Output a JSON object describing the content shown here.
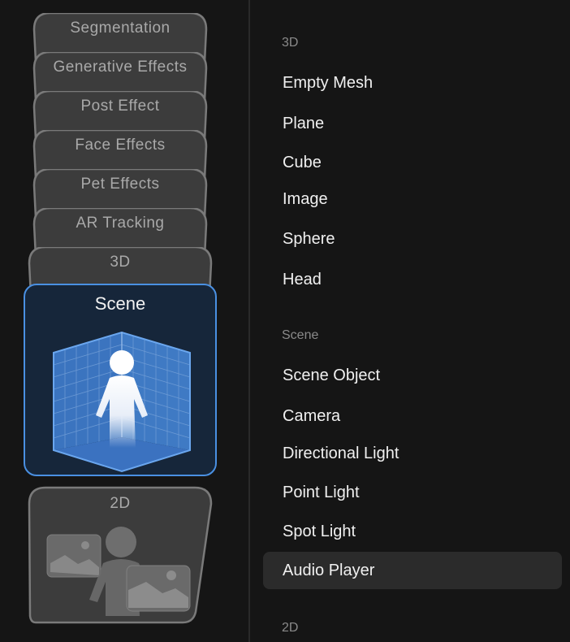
{
  "stack": {
    "cards": [
      {
        "label": "Segmentation"
      },
      {
        "label": "Generative Effects"
      },
      {
        "label": "Post Effect"
      },
      {
        "label": "Face Effects"
      },
      {
        "label": "Pet Effects"
      },
      {
        "label": "AR Tracking"
      },
      {
        "label": "3D"
      }
    ],
    "selected": {
      "label": "Scene",
      "icon": "scene-person-in-grid-room-icon"
    },
    "next": {
      "label": "2D",
      "icon": "person-with-images-icon"
    }
  },
  "list": {
    "sections": [
      {
        "header": "3D",
        "items": [
          "Empty Mesh",
          "Plane",
          "Cube",
          "Image",
          "Sphere",
          "Head"
        ]
      },
      {
        "header": "Scene",
        "items": [
          "Scene Object",
          "Camera",
          "Directional Light",
          "Point Light",
          "Spot Light",
          "Audio Player"
        ]
      },
      {
        "header": "2D",
        "items": []
      }
    ],
    "highlighted": "Audio Player"
  },
  "colors": {
    "accent": "#4a90e2",
    "selected_bg": "#16263a",
    "card_bg": "#3a3a3a",
    "card_border": "#777777",
    "background": "#151515"
  }
}
